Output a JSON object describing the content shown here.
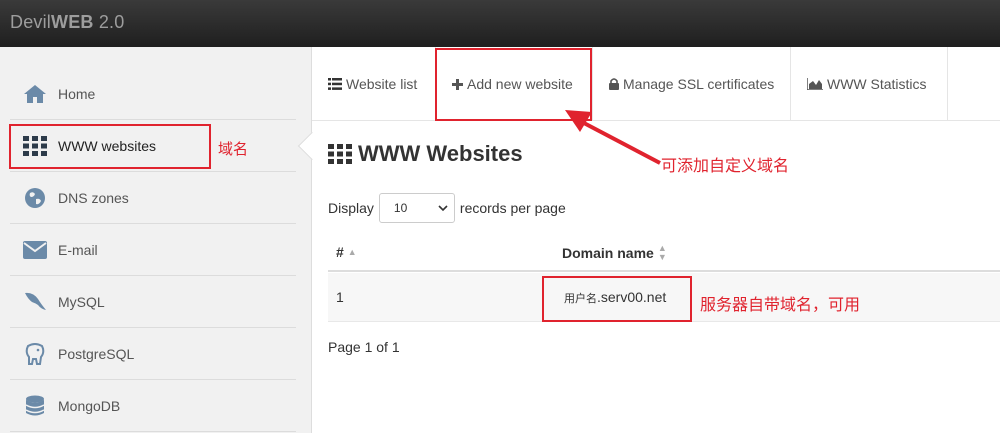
{
  "app": {
    "brand_prefix": "Devil",
    "brand_bold": "WEB",
    "brand_version": " 2.0"
  },
  "sidebar": {
    "items": [
      {
        "label": "Home",
        "icon": "home-icon"
      },
      {
        "label": "WWW websites",
        "icon": "grid-icon",
        "active": true
      },
      {
        "label": "DNS zones",
        "icon": "globe-icon"
      },
      {
        "label": "E-mail",
        "icon": "envelope-icon"
      },
      {
        "label": "MySQL",
        "icon": "dolphin-icon"
      },
      {
        "label": "PostgreSQL",
        "icon": "elephant-icon"
      },
      {
        "label": "MongoDB",
        "icon": "database-icon"
      }
    ]
  },
  "tabs": [
    {
      "label": "Website list",
      "icon": "list-icon"
    },
    {
      "label": "Add new website",
      "icon": "plus-icon"
    },
    {
      "label": "Manage SSL certificates",
      "icon": "lock-icon"
    },
    {
      "label": "WWW Statistics",
      "icon": "area-chart-icon"
    }
  ],
  "main": {
    "title": "WWW Websites",
    "display_label": "Display",
    "records_label": "records per page",
    "page_size": "10",
    "columns": [
      "#",
      "Domain name"
    ],
    "rows": [
      {
        "index": "1",
        "domain_prefix": "用户名",
        "domain_suffix": ".serv00.net"
      }
    ],
    "page_info": "Page 1 of 1"
  },
  "annotations": {
    "sidebar_note": "域名",
    "add_note": "可添加自定义域名",
    "domain_note": "服务器自带域名，可用"
  },
  "colors": {
    "annotation": "#e0232e",
    "icon": "#6b8aa8",
    "topbar": "#222222"
  }
}
